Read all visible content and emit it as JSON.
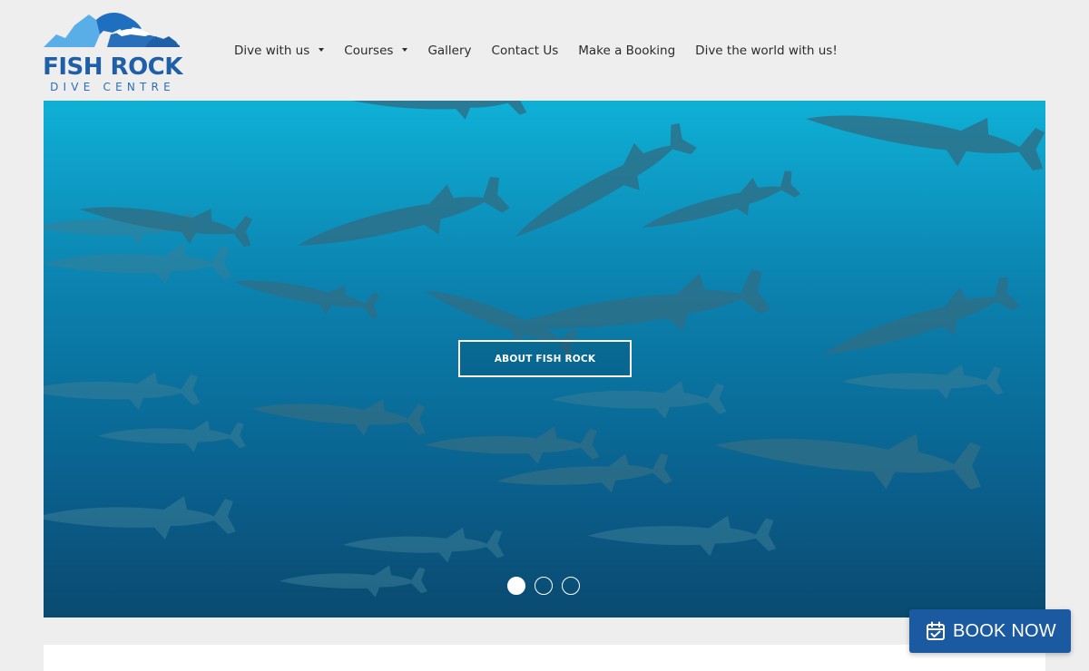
{
  "logo": {
    "title": "FISH ROCK",
    "subtitle": "DIVE CENTRE",
    "icon": "mountain-shark-logo-icon"
  },
  "nav": {
    "items": [
      {
        "label": "Dive with us",
        "has_dropdown": true
      },
      {
        "label": "Courses",
        "has_dropdown": true
      },
      {
        "label": "Gallery",
        "has_dropdown": false
      },
      {
        "label": "Contact Us",
        "has_dropdown": false
      },
      {
        "label": "Make a Booking",
        "has_dropdown": false
      },
      {
        "label": "Dive the world with us!",
        "has_dropdown": false
      }
    ]
  },
  "hero": {
    "cta_label": "ABOUT FISH ROCK",
    "slide_count": 3,
    "active_slide": 1
  },
  "book_now": {
    "label": "BOOK NOW",
    "icon": "calendar-check-icon"
  },
  "colors": {
    "brand_blue": "#1f5fa8",
    "button_blue": "#1b5aa0",
    "page_bg": "#eeeeee"
  }
}
